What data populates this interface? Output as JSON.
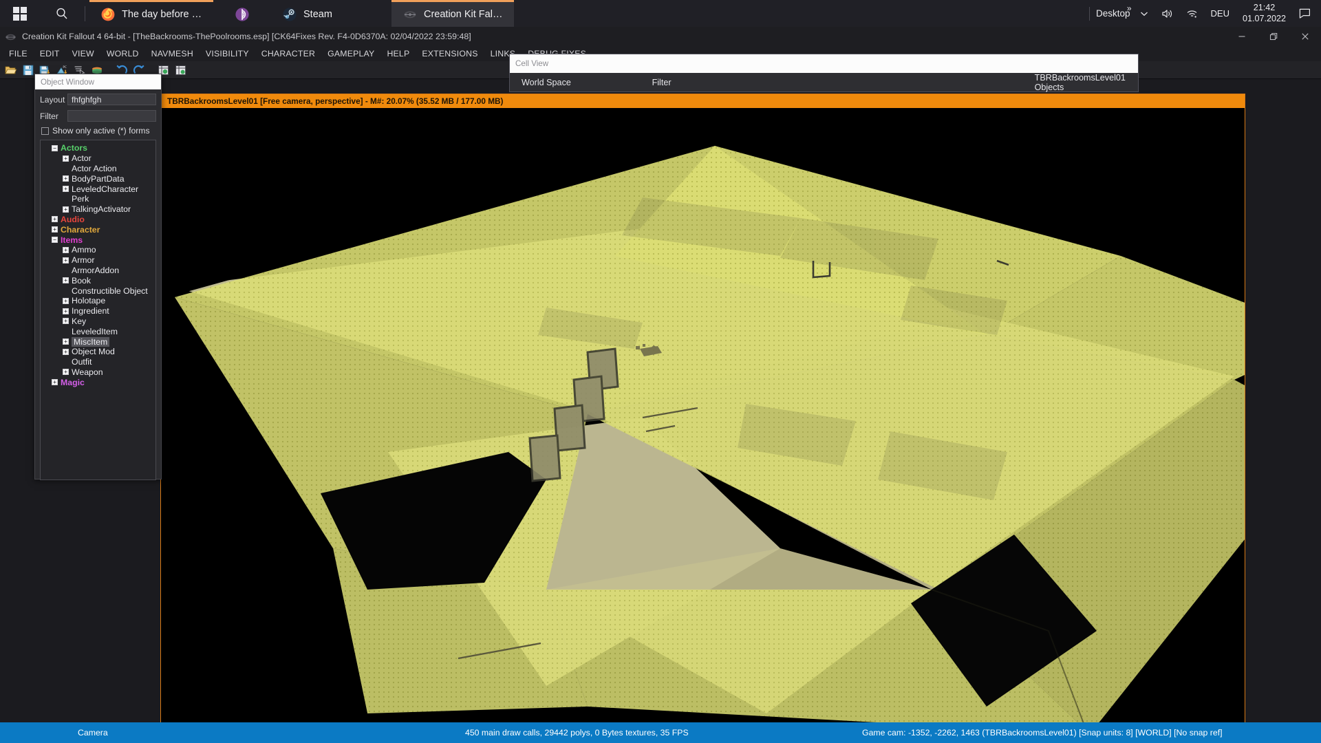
{
  "taskbar": {
    "start_icon": "windows-logo-icon",
    "search_icon": "search-icon",
    "tasks": [
      {
        "label": "The day before the ...",
        "icon": "firefox-icon",
        "active": false
      },
      {
        "label": "",
        "icon": "tor-browser-icon",
        "active": false
      },
      {
        "label": "Steam",
        "icon": "steam-icon",
        "active": false
      },
      {
        "label": "Creation Kit Fallout...",
        "icon": "creation-kit-icon",
        "active": true
      }
    ],
    "tray": {
      "desktop_label": "Desktop",
      "overflow_icon": "chevron-up-icon",
      "chevron_icon": "chevron-up-icon",
      "volume_icon": "volume-icon",
      "network_icon": "wifi-icon",
      "language": "DEU",
      "time": "21:42",
      "date": "01.07.2022",
      "action_center_icon": "notification-icon"
    }
  },
  "app": {
    "title": "Creation Kit Fallout 4 64-bit - [TheBackrooms-ThePoolrooms.esp] [CK64Fixes Rev. F4-0D6370A: 02/04/2022 23:59:48]",
    "app_icon": "creation-kit-icon",
    "window_controls": {
      "minimize": "minimize-icon",
      "restore": "restore-icon",
      "close": "close-icon"
    },
    "menu": [
      "FILE",
      "EDIT",
      "VIEW",
      "WORLD",
      "NAVMESH",
      "VISIBILITY",
      "CHARACTER",
      "GAMEPLAY",
      "HELP",
      "EXTENSIONS",
      "LINKS",
      "DEBUG FIXES"
    ],
    "toolbar": [
      "open-folder-icon",
      "save-icon",
      "save-pc-icon",
      "load-pc-icon",
      "select-cursor-icon",
      "render-window-icon",
      "undo-icon",
      "redo-icon",
      "object-window-icon",
      "cell-view-icon"
    ]
  },
  "object_window": {
    "title": "Object Window",
    "layout_label": "Layout",
    "layout_value": "fhfghfgh",
    "filter_label": "Filter",
    "filter_value": "",
    "show_active_label": "Show only active (*) forms",
    "show_active_checked": false,
    "tree": [
      {
        "label": "Actors",
        "level": 0,
        "toggle": "minus",
        "color": "#57d06a",
        "selected": false
      },
      {
        "label": "Actor",
        "level": 1,
        "toggle": "plus",
        "color": "#eaeaee",
        "selected": false
      },
      {
        "label": "Actor Action",
        "level": 1,
        "toggle": "none",
        "color": "#eaeaee",
        "selected": false
      },
      {
        "label": "BodyPartData",
        "level": 1,
        "toggle": "plus",
        "color": "#eaeaee",
        "selected": false
      },
      {
        "label": "LeveledCharacter",
        "level": 1,
        "toggle": "plus",
        "color": "#eaeaee",
        "selected": false
      },
      {
        "label": "Perk",
        "level": 1,
        "toggle": "none",
        "color": "#eaeaee",
        "selected": false
      },
      {
        "label": "TalkingActivator",
        "level": 1,
        "toggle": "plus",
        "color": "#eaeaee",
        "selected": false
      },
      {
        "label": "Audio",
        "level": 0,
        "toggle": "plus",
        "color": "#e8453c",
        "selected": false
      },
      {
        "label": "Character",
        "level": 0,
        "toggle": "plus",
        "color": "#e0a83c",
        "selected": false
      },
      {
        "label": "Items",
        "level": 0,
        "toggle": "minus",
        "color": "#e040d0",
        "selected": false
      },
      {
        "label": "Ammo",
        "level": 1,
        "toggle": "plus",
        "color": "#eaeaee",
        "selected": false
      },
      {
        "label": "Armor",
        "level": 1,
        "toggle": "plus",
        "color": "#eaeaee",
        "selected": false
      },
      {
        "label": "ArmorAddon",
        "level": 1,
        "toggle": "none",
        "color": "#eaeaee",
        "selected": false
      },
      {
        "label": "Book",
        "level": 1,
        "toggle": "plus",
        "color": "#eaeaee",
        "selected": false
      },
      {
        "label": "Constructible Object",
        "level": 1,
        "toggle": "none",
        "color": "#eaeaee",
        "selected": false
      },
      {
        "label": "Holotape",
        "level": 1,
        "toggle": "plus",
        "color": "#eaeaee",
        "selected": false
      },
      {
        "label": "Ingredient",
        "level": 1,
        "toggle": "plus",
        "color": "#eaeaee",
        "selected": false
      },
      {
        "label": "Key",
        "level": 1,
        "toggle": "plus",
        "color": "#eaeaee",
        "selected": false
      },
      {
        "label": "LeveledItem",
        "level": 1,
        "toggle": "none",
        "color": "#eaeaee",
        "selected": false
      },
      {
        "label": "MiscItem",
        "level": 1,
        "toggle": "plus",
        "color": "#eaeaee",
        "selected": true
      },
      {
        "label": "Object Mod",
        "level": 1,
        "toggle": "plus",
        "color": "#eaeaee",
        "selected": false
      },
      {
        "label": "Outfit",
        "level": 1,
        "toggle": "none",
        "color": "#eaeaee",
        "selected": false
      },
      {
        "label": "Weapon",
        "level": 1,
        "toggle": "plus",
        "color": "#eaeaee",
        "selected": false
      },
      {
        "label": "Magic",
        "level": 0,
        "toggle": "plus",
        "color": "#d35fe8",
        "selected": false
      }
    ]
  },
  "cell_view": {
    "title": "Cell View",
    "columns": [
      "World Space",
      "Filter",
      "TBRBackroomsLevel01 Objects"
    ]
  },
  "render_window": {
    "title": "TBRBackroomsLevel01 [Free camera, perspective] - M#: 20.07% (35.52 MB / 177.00 MB)",
    "cell": "TBRBackroomsLevel01",
    "camera_mode": "Free camera, perspective",
    "memory_percent": "20.07%",
    "memory_used": "35.52 MB",
    "memory_total": "177.00 MB",
    "border_color": "#d97a16",
    "title_bg": "#f08a0c"
  },
  "status_bar": {
    "left": "Camera",
    "center": "450 main draw calls, 29442 polys, 0 Bytes textures, 35 FPS",
    "right": "Game cam: -1352, -2262, 1463 (TBRBackroomsLevel01) [Snap units: 8] [WORLD] [No snap ref]",
    "bg_color": "#0b7ac4"
  }
}
